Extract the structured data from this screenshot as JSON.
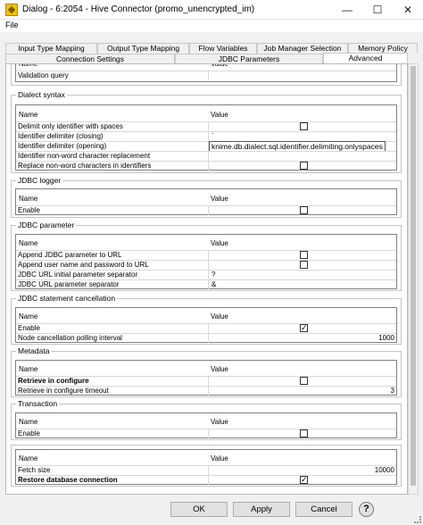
{
  "window": {
    "title": "Dialog - 6:2054 - Hive Connector (promo_unencrypted_im)",
    "minimize": "—",
    "maximize": "☐",
    "close": "✕"
  },
  "menu": {
    "file": "File"
  },
  "tabs_back": [
    "Input Type Mapping",
    "Output Type Mapping",
    "Flow Variables",
    "Job Manager Selection",
    "Memory Policy"
  ],
  "tabs_front": [
    "Connection Settings",
    "JDBC Parameters",
    "Advanced"
  ],
  "active_tab": "Advanced",
  "table_headers": {
    "name": "Name",
    "value": "Value"
  },
  "top_partial": {
    "row_label": "Validation query"
  },
  "groups": {
    "dialect": {
      "title": "Dialect syntax",
      "rows": [
        {
          "label": "Delimit only identifier with spaces",
          "checked": false
        },
        {
          "label": "Identifier delimiter (closing)",
          "value": "`"
        },
        {
          "label": "Identifier delimiter (opening)",
          "value": "knime.db.dialect.sql.identifier.delimiting.onlyspaces"
        },
        {
          "label": "Identifier non-word character replacement",
          "value": ""
        },
        {
          "label": "Replace non-word characters in identifiers",
          "checked": false
        }
      ]
    },
    "logger": {
      "title": "JDBC logger",
      "rows": [
        {
          "label": "Enable",
          "checked": false
        }
      ]
    },
    "param": {
      "title": "JDBC parameter",
      "rows": [
        {
          "label": "Append JDBC parameter to URL",
          "checked": false
        },
        {
          "label": "Append user name and password to URL",
          "checked": false
        },
        {
          "label": "JDBC URL initial parameter separator",
          "value": "?"
        },
        {
          "label": "JDBC URL parameter separator",
          "value": "&"
        }
      ]
    },
    "cancel": {
      "title": "JDBC statement cancellation",
      "rows": [
        {
          "label": "Enable",
          "checked": true
        },
        {
          "label": "Node cancellation polling interval",
          "value": "1000"
        }
      ]
    },
    "metadata": {
      "title": "Metadata",
      "rows": [
        {
          "label": "Retrieve in configure",
          "checked": false
        },
        {
          "label": "Retrieve in configure timeout",
          "value": "3"
        }
      ]
    },
    "transaction": {
      "title": "Transaction",
      "rows": [
        {
          "label": "Enable",
          "checked": false
        }
      ]
    },
    "misc": {
      "title": "",
      "rows": [
        {
          "label": "Fetch size",
          "value": "10000"
        },
        {
          "label": "Restore database connection",
          "checked": true
        }
      ]
    }
  },
  "buttons": {
    "ok": "OK",
    "apply": "Apply",
    "cancel": "Cancel",
    "help": "?"
  }
}
